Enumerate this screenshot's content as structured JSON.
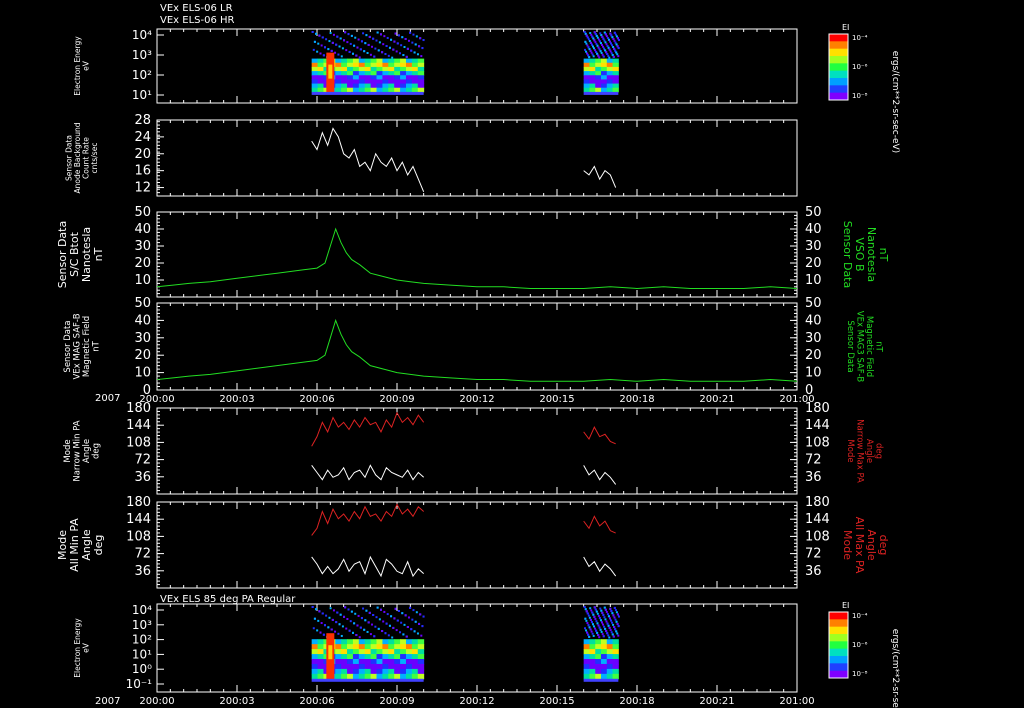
{
  "titles": {
    "top_line1": "VEx ELS-06 LR",
    "top_line2": "VEx ELS-06 HR",
    "bottom": "VEx ELS 85 deg PA Regular"
  },
  "year_label": "2007",
  "colorbar": {
    "label": "EI",
    "units": "ergs/(cm**2-sr-sec-eV)",
    "ticks": [
      "10⁻⁴",
      "10⁻⁶",
      "10⁻⁸"
    ]
  },
  "colors": {
    "background": "#000000",
    "axis": "#ffffff",
    "green_trace": "#22dd22",
    "red_trace": "#dd2222",
    "white_trace": "#ffffff"
  },
  "chart_data": [
    {
      "type": "heatmap",
      "ylabel": [
        "Electron Energy",
        "eV"
      ],
      "y_ticks": [
        "10⁴",
        "10³",
        "10²",
        "10¹"
      ],
      "x_ticks": [
        "200:00",
        "200:03",
        "200:06",
        "200:09",
        "200:12",
        "200:15",
        "200:18",
        "200:21",
        "201:00"
      ],
      "scale": "log",
      "data_intervals": [
        [
          5.8,
          10.0
        ],
        [
          16.0,
          17.3
        ]
      ]
    },
    {
      "type": "line",
      "ylabel": [
        "Sensor Data",
        "Anode Background",
        "Count Rate",
        "cnts/sec"
      ],
      "ylim": [
        10,
        28
      ],
      "y_ticks": [
        12,
        16,
        20,
        24,
        28
      ],
      "series": [
        {
          "x": [
            5.8,
            6.0,
            6.2,
            6.4,
            6.6,
            6.8,
            7.0,
            7.2,
            7.4,
            7.6,
            7.8,
            8.0,
            8.2,
            8.4,
            8.6,
            8.8,
            9.0,
            9.2,
            9.4,
            9.6,
            9.8,
            10.0
          ],
          "y": [
            23,
            21,
            25,
            22,
            26,
            24,
            20,
            19,
            21,
            17,
            18,
            16,
            20,
            18,
            17,
            19,
            16,
            18,
            15,
            17,
            14,
            11
          ]
        },
        {
          "x": [
            16.0,
            16.2,
            16.4,
            16.6,
            16.8,
            17.0,
            17.2
          ],
          "y": [
            16,
            15,
            17,
            14,
            16,
            15,
            12
          ]
        }
      ]
    },
    {
      "type": "line",
      "ylabel": [
        "Sensor Data",
        "S/C Btot",
        "Nanotesla",
        "nT"
      ],
      "right_label": [
        "Sensor Data",
        "VSO B",
        "Nanotesla",
        "nT"
      ],
      "ylim": [
        0,
        50
      ],
      "y_ticks": [
        10,
        20,
        30,
        40,
        50
      ],
      "series": [
        {
          "x": [
            0,
            0.6,
            1.2,
            2,
            3,
            4,
            4.5,
            5,
            5.5,
            6,
            6.3,
            6.5,
            6.7,
            6.9,
            7.1,
            7.3,
            7.6,
            8,
            8.5,
            9,
            9.5,
            10,
            11,
            12,
            13,
            14,
            15,
            16,
            17,
            18,
            19,
            20,
            21,
            22,
            23,
            24
          ],
          "y": [
            6,
            7,
            8,
            9,
            11,
            13,
            14,
            15,
            16,
            17,
            20,
            30,
            40,
            32,
            26,
            22,
            19,
            14,
            12,
            10,
            9,
            8,
            7,
            6,
            6,
            5,
            5,
            5,
            6,
            5,
            6,
            5,
            5,
            5,
            6,
            5
          ]
        }
      ]
    },
    {
      "type": "line",
      "ylabel": [
        "Sensor Data",
        "VEx MAG SAF-B",
        "Magnetic Field",
        "nT"
      ],
      "right_label": [
        "Sensor Data",
        "VEx MAG3 SAF-B",
        "Magnetic Field",
        "nT"
      ],
      "ylim": [
        0,
        50
      ],
      "y_ticks": [
        0,
        10,
        20,
        30,
        40,
        50
      ],
      "series": [
        {
          "x": [
            0,
            0.6,
            1.2,
            2,
            3,
            4,
            4.5,
            5,
            5.5,
            6,
            6.3,
            6.5,
            6.7,
            6.9,
            7.1,
            7.3,
            7.6,
            8,
            8.5,
            9,
            9.5,
            10,
            11,
            12,
            13,
            14,
            15,
            16,
            17,
            18,
            19,
            20,
            21,
            22,
            23,
            24
          ],
          "y": [
            6,
            7,
            8,
            9,
            11,
            13,
            14,
            15,
            16,
            17,
            20,
            30,
            40,
            32,
            26,
            22,
            19,
            14,
            12,
            10,
            9,
            8,
            7,
            6,
            6,
            5,
            5,
            5,
            6,
            5,
            6,
            5,
            5,
            5,
            6,
            5
          ]
        }
      ]
    },
    {
      "type": "line",
      "ylabel": [
        "Mode",
        "Narrow Min PA",
        "Angle",
        "deg"
      ],
      "right_label": [
        "Mode",
        "Narrow Max PA",
        "Angle",
        "deg"
      ],
      "ylim": [
        0,
        180
      ],
      "y_ticks": [
        36,
        72,
        108,
        144,
        180
      ],
      "series": [
        {
          "name": "Max PA",
          "x": [
            5.8,
            6.0,
            6.2,
            6.4,
            6.6,
            6.8,
            7.0,
            7.2,
            7.4,
            7.6,
            7.8,
            8.0,
            8.2,
            8.4,
            8.6,
            8.8,
            9.0,
            9.2,
            9.4,
            9.6,
            9.8,
            10.0,
            16.0,
            16.2,
            16.4,
            16.6,
            16.8,
            17.0,
            17.2
          ],
          "y": [
            100,
            120,
            150,
            130,
            160,
            140,
            150,
            135,
            155,
            140,
            160,
            145,
            150,
            130,
            155,
            140,
            170,
            150,
            160,
            145,
            165,
            150,
            130,
            115,
            140,
            120,
            125,
            110,
            105
          ]
        },
        {
          "name": "Min PA",
          "x": [
            5.8,
            6.0,
            6.2,
            6.4,
            6.6,
            6.8,
            7.0,
            7.2,
            7.4,
            7.6,
            7.8,
            8.0,
            8.2,
            8.4,
            8.6,
            8.8,
            9.0,
            9.2,
            9.4,
            9.6,
            9.8,
            10.0,
            16.0,
            16.2,
            16.4,
            16.6,
            16.8,
            17.0,
            17.2
          ],
          "y": [
            60,
            45,
            30,
            50,
            35,
            40,
            55,
            30,
            45,
            50,
            35,
            60,
            40,
            30,
            55,
            45,
            40,
            35,
            50,
            30,
            45,
            35,
            60,
            40,
            50,
            30,
            45,
            35,
            20
          ]
        }
      ]
    },
    {
      "type": "line",
      "ylabel": [
        "Mode",
        "All Min PA",
        "Angle",
        "deg"
      ],
      "right_label": [
        "Mode",
        "All Max PA",
        "Angle",
        "deg"
      ],
      "ylim": [
        0,
        180
      ],
      "y_ticks": [
        36,
        72,
        108,
        144,
        180
      ],
      "series": [
        {
          "name": "Max PA",
          "x": [
            5.8,
            6.0,
            6.2,
            6.4,
            6.6,
            6.8,
            7.0,
            7.2,
            7.4,
            7.6,
            7.8,
            8.0,
            8.2,
            8.4,
            8.6,
            8.8,
            9.0,
            9.2,
            9.4,
            9.6,
            9.8,
            10.0,
            16.0,
            16.2,
            16.4,
            16.6,
            16.8,
            17.0,
            17.2
          ],
          "y": [
            110,
            125,
            160,
            135,
            165,
            145,
            155,
            140,
            160,
            145,
            170,
            150,
            155,
            140,
            160,
            150,
            175,
            155,
            165,
            150,
            170,
            160,
            140,
            125,
            150,
            130,
            140,
            120,
            115
          ]
        },
        {
          "name": "Min PA",
          "x": [
            5.8,
            6.0,
            6.2,
            6.4,
            6.6,
            6.8,
            7.0,
            7.2,
            7.4,
            7.6,
            7.8,
            8.0,
            8.2,
            8.4,
            8.6,
            8.8,
            9.0,
            9.2,
            9.4,
            9.6,
            9.8,
            10.0,
            16.0,
            16.2,
            16.4,
            16.6,
            16.8,
            17.0,
            17.2
          ],
          "y": [
            65,
            50,
            30,
            45,
            30,
            40,
            60,
            35,
            50,
            55,
            30,
            65,
            45,
            25,
            60,
            50,
            35,
            30,
            55,
            25,
            40,
            30,
            65,
            45,
            55,
            35,
            50,
            40,
            25
          ]
        }
      ]
    },
    {
      "type": "heatmap",
      "ylabel": [
        "Electron Energy",
        "eV"
      ],
      "y_ticks": [
        "10⁴",
        "10³",
        "10²",
        "10¹",
        "10⁰",
        "10⁻¹"
      ],
      "x_ticks": [
        "200:00",
        "200:03",
        "200:06",
        "200:09",
        "200:12",
        "200:15",
        "200:18",
        "200:21",
        "201:00"
      ],
      "scale": "log",
      "data_intervals": [
        [
          5.8,
          10.0
        ],
        [
          16.0,
          17.3
        ]
      ]
    }
  ]
}
